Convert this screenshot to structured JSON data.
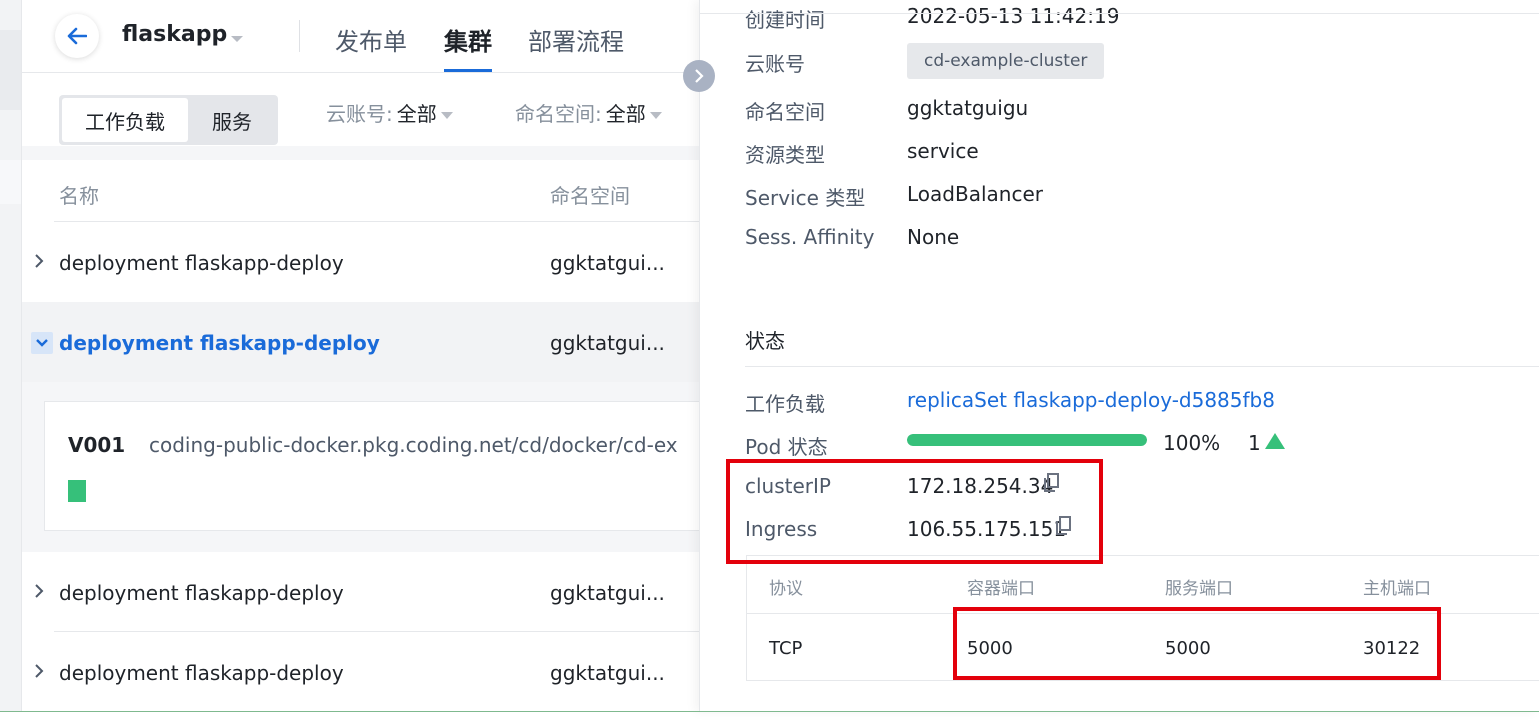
{
  "header": {
    "app_name": "flaskapp",
    "tabs": [
      {
        "label": "发布单",
        "active": false
      },
      {
        "label": "集群",
        "active": true
      },
      {
        "label": "部署流程",
        "active": false
      }
    ]
  },
  "filters": {
    "segment": [
      "工作负载",
      "服务"
    ],
    "cloud_account_label": "云账号:",
    "cloud_account_value": "全部",
    "namespace_label": "命名空间:",
    "namespace_value": "全部"
  },
  "table": {
    "headers": [
      "名称",
      "命名空间"
    ],
    "rows": [
      {
        "name": "deployment flaskapp-deploy",
        "namespace": "ggktatgui...",
        "expanded": false
      },
      {
        "name": "deployment flaskapp-deploy",
        "namespace": "ggktatgui...",
        "expanded": true
      },
      {
        "name": "deployment flaskapp-deploy",
        "namespace": "ggktatgui...",
        "expanded": false
      },
      {
        "name": "deployment flaskapp-deploy",
        "namespace": "ggktatgui...",
        "expanded": false
      }
    ],
    "expanded_detail": {
      "version": "V001",
      "image": "coding-public-docker.pkg.coding.net/cd/docker/cd-ex"
    }
  },
  "drawer": {
    "created_label": "创建时间",
    "created_value": "2022-05-13 11:42:19",
    "cloud_account_label": "云账号",
    "cloud_account_value": "cd-example-cluster",
    "namespace_label": "命名空间",
    "namespace_value": "ggktatguigu",
    "resource_type_label": "资源类型",
    "resource_type_value": "service",
    "service_type_label": "Service 类型",
    "service_type_value": "LoadBalancer",
    "affinity_label": "Sess. Affinity",
    "affinity_value": "None",
    "status_title": "状态",
    "workload_label": "工作负载",
    "workload_value": "replicaSet flaskapp-deploy-d5885fb8",
    "pod_label": "Pod 状态",
    "pod_percent": "100%",
    "pod_progress": 1.0,
    "pod_count": "1",
    "cluster_ip_label": "clusterIP",
    "cluster_ip_value": "172.18.254.34",
    "ingress_label": "Ingress",
    "ingress_value": "106.55.175.151",
    "ports": {
      "headers": [
        "协议",
        "容器端口",
        "服务端口",
        "主机端口"
      ],
      "rows": [
        [
          "TCP",
          "5000",
          "5000",
          "30122"
        ]
      ]
    }
  },
  "colors": {
    "accent": "#1a6bd9",
    "success": "#36c07a",
    "highlight": "#e3000b"
  }
}
